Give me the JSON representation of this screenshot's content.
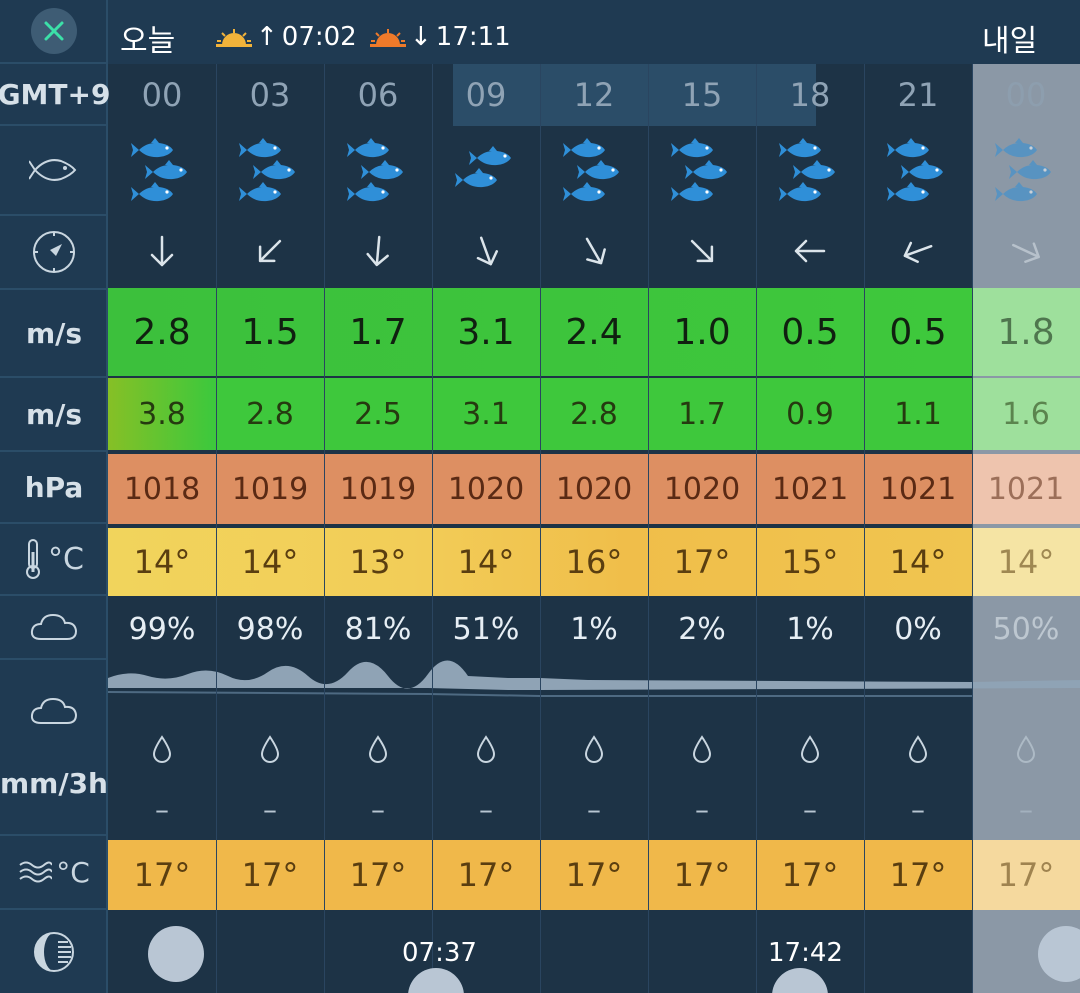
{
  "header": {
    "today_label": "오늘",
    "tomorrow_label": "내일",
    "sunrise": "07:02",
    "sunset": "17:11",
    "timezone": "GMT+9"
  },
  "sidebar": {
    "wind_unit": "m/s",
    "gust_unit": "m/s",
    "pressure_unit": "hPa",
    "temp_unit": "°C",
    "precip_unit": "mm/3h",
    "sea_temp_unit": "°C"
  },
  "columns": [
    {
      "hour": "00",
      "fish": 3,
      "dir_deg": 180,
      "wind": "2.8",
      "gust": "3.8",
      "pressure": "1018",
      "temp": "14°",
      "cloud": "99%",
      "precip": "–",
      "sea": "17°"
    },
    {
      "hour": "03",
      "fish": 3,
      "dir_deg": 225,
      "wind": "1.5",
      "gust": "2.8",
      "pressure": "1019",
      "temp": "14°",
      "cloud": "98%",
      "precip": "–",
      "sea": "17°"
    },
    {
      "hour": "06",
      "fish": 3,
      "dir_deg": 185,
      "wind": "1.7",
      "gust": "2.5",
      "pressure": "1019",
      "temp": "13°",
      "cloud": "81%",
      "precip": "–",
      "sea": "17°"
    },
    {
      "hour": "09",
      "fish": 2,
      "dir_deg": 160,
      "wind": "3.1",
      "gust": "3.1",
      "pressure": "1020",
      "temp": "14°",
      "cloud": "51%",
      "precip": "–",
      "sea": "17°"
    },
    {
      "hour": "12",
      "fish": 3,
      "dir_deg": 150,
      "wind": "2.4",
      "gust": "2.8",
      "pressure": "1020",
      "temp": "16°",
      "cloud": "1%",
      "precip": "–",
      "sea": "17°"
    },
    {
      "hour": "15",
      "fish": 3,
      "dir_deg": 135,
      "wind": "1.0",
      "gust": "1.7",
      "pressure": "1020",
      "temp": "17°",
      "cloud": "2%",
      "precip": "–",
      "sea": "17°"
    },
    {
      "hour": "18",
      "fish": 3,
      "dir_deg": 270,
      "wind": "0.5",
      "gust": "0.9",
      "pressure": "1021",
      "temp": "15°",
      "cloud": "1%",
      "precip": "–",
      "sea": "17°"
    },
    {
      "hour": "21",
      "fish": 3,
      "dir_deg": 250,
      "wind": "0.5",
      "gust": "1.1",
      "pressure": "1021",
      "temp": "14°",
      "cloud": "0%",
      "precip": "–",
      "sea": "17°"
    },
    {
      "hour": "00",
      "fish": 3,
      "dir_deg": 115,
      "wind": "1.8",
      "gust": "1.6",
      "pressure": "1021",
      "temp": "14°",
      "cloud": "50%",
      "precip": "–",
      "sea": "17°"
    }
  ],
  "moon": {
    "moonrise": "07:37",
    "moonset": "17:42"
  },
  "colors": {
    "fish": "#2f8fd8",
    "wind_band": "#3ec83c",
    "pressure_band": "#dd8f62",
    "temp_band": "#f0c550",
    "sea_band": "#f0b84a",
    "close_icon": "#3ce0a8"
  }
}
